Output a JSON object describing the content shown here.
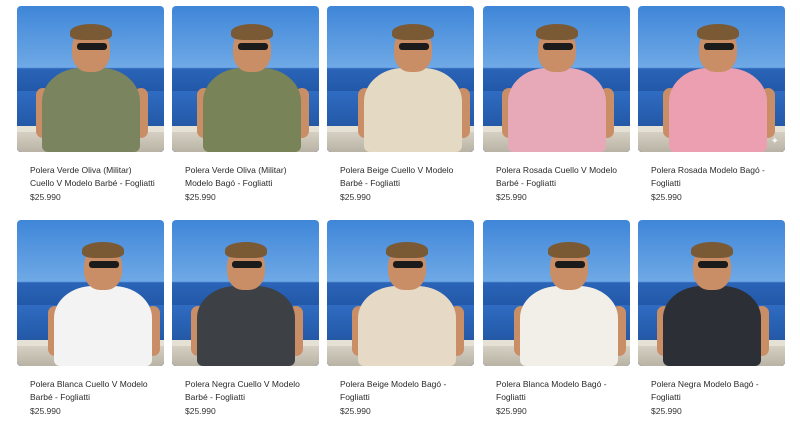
{
  "products": [
    {
      "title": "Polera Verde Oliva (Militar) Cuello V Modelo Barbé - Fogliatti",
      "price": "$25.990",
      "shirt_color": "#7a8560"
    },
    {
      "title": "Polera Verde Oliva (Militar) Modelo Bagó - Fogliatti",
      "price": "$25.990",
      "shirt_color": "#788458"
    },
    {
      "title": "Polera Beige Cuello V Modelo Barbé - Fogliatti",
      "price": "$25.990",
      "shirt_color": "#e4d9c2"
    },
    {
      "title": "Polera Rosada Cuello V Modelo Barbé - Fogliatti",
      "price": "$25.990",
      "shirt_color": "#e7a9b8"
    },
    {
      "title": "Polera Rosada Modelo Bagó - Fogliatti",
      "price": "$25.990",
      "shirt_color": "#ec9fb0"
    },
    {
      "title": "Polera Blanca Cuello V Modelo Barbé - Fogliatti",
      "price": "$25.990",
      "shirt_color": "#f3f3f3"
    },
    {
      "title": "Polera Negra Cuello V Modelo Barbé - Fogliatti",
      "price": "$25.990",
      "shirt_color": "#3d4044"
    },
    {
      "title": "Polera Beige Modelo Bagó - Fogliatti",
      "price": "$25.990",
      "shirt_color": "#e6dac6"
    },
    {
      "title": "Polera Blanca Modelo Bagó - Fogliatti",
      "price": "$25.990",
      "shirt_color": "#f1efe8"
    },
    {
      "title": "Polera Negra Modelo Bagó - Fogliatti",
      "price": "$25.990",
      "shirt_color": "#2c3036"
    }
  ],
  "icons": {
    "sparkle": "✦"
  }
}
